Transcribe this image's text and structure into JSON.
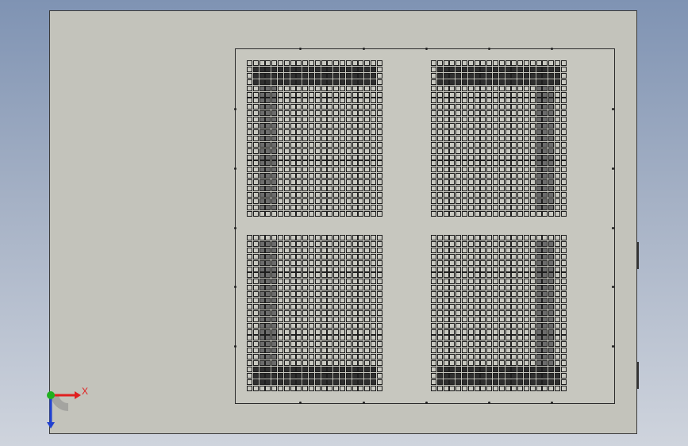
{
  "viewport": {
    "background_top": "#7f93b3",
    "background_bottom": "#cfd4dd"
  },
  "drawing": {
    "sheet_color": "#c3c3bb",
    "panel": {
      "blocks": [
        {
          "id": "top-left"
        },
        {
          "id": "top-right"
        },
        {
          "id": "bottom-left"
        },
        {
          "id": "bottom-right"
        }
      ],
      "grid_cols": 22,
      "grid_rows": 25
    }
  },
  "triad": {
    "x_label": "X",
    "x_color": "#e02020",
    "y_color": "#20b020",
    "z_color": "#2040d0"
  }
}
